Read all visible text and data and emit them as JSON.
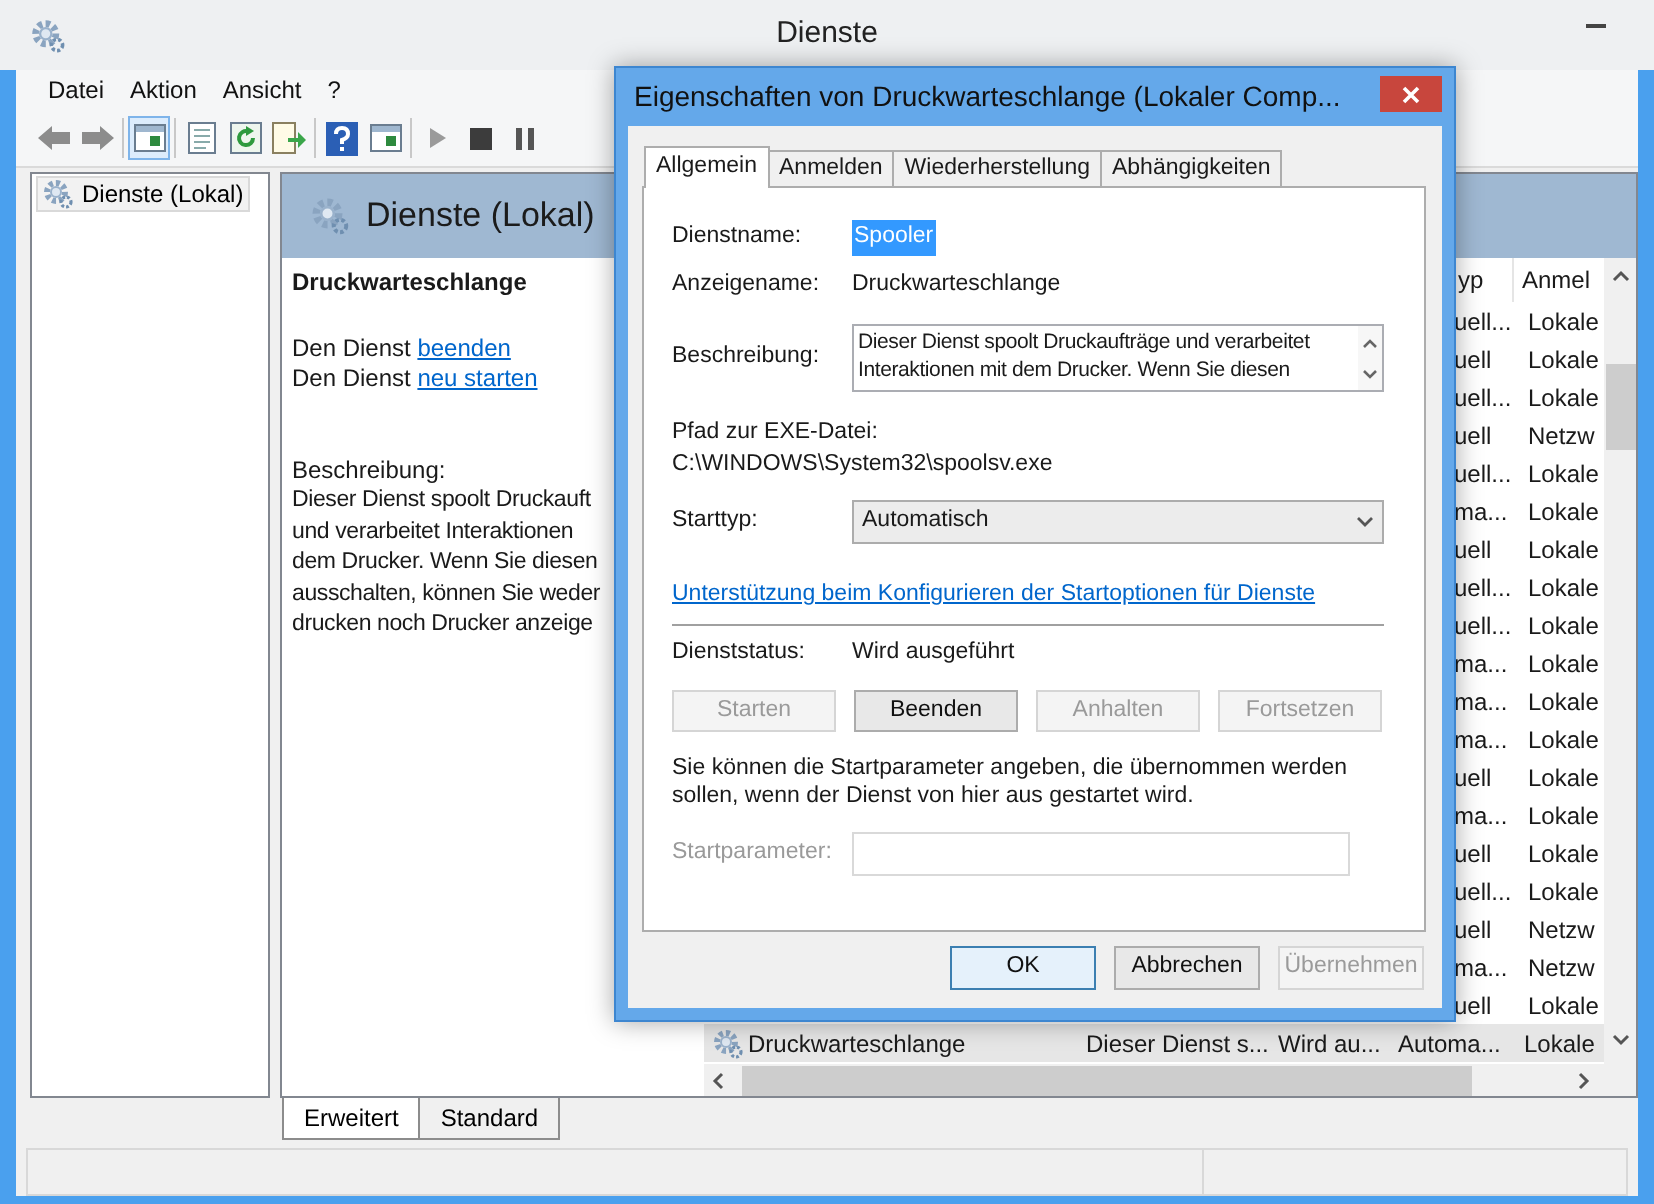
{
  "window": {
    "title": "Dienste"
  },
  "menu": [
    "Datei",
    "Aktion",
    "Ansicht",
    "?"
  ],
  "tree": [
    {
      "label": "Dienste (Lokal)",
      "selected": true
    }
  ],
  "panel_header": "Dienste (Lokal)",
  "details": {
    "title": "Druckwarteschlange",
    "actions": [
      {
        "prefix": "Den Dienst",
        "link": "beenden"
      },
      {
        "prefix": "Den Dienst",
        "link": "neu starten"
      }
    ],
    "description_label": "Beschreibung:",
    "description_lines": [
      "Dieser Dienst spoolt Druckauft",
      "und verarbeitet Interaktionen",
      "dem Drucker. Wenn Sie diesen",
      "ausschalten, können Sie weder",
      "drucken noch Drucker anzeige"
    ]
  },
  "list": {
    "columns": [
      "yp",
      "Anmel"
    ],
    "rows": [
      {
        "kind": "partial",
        "cells": [
          "uell...",
          "Lokale"
        ],
        "selected": false
      },
      {
        "kind": "partial",
        "cells": [
          "uell",
          "Lokale"
        ],
        "selected": false
      },
      {
        "kind": "partial",
        "cells": [
          "uell...",
          "Lokale"
        ],
        "selected": false
      },
      {
        "kind": "partial",
        "cells": [
          "uell",
          "Netzw"
        ],
        "selected": false
      },
      {
        "kind": "partial",
        "cells": [
          "uell...",
          "Lokale"
        ],
        "selected": false
      },
      {
        "kind": "partial",
        "cells": [
          "ma...",
          "Lokale"
        ],
        "selected": false
      },
      {
        "kind": "partial",
        "cells": [
          "uell",
          "Lokale"
        ],
        "selected": false
      },
      {
        "kind": "partial",
        "cells": [
          "uell...",
          "Lokale"
        ],
        "selected": false
      },
      {
        "kind": "partial",
        "cells": [
          "uell...",
          "Lokale"
        ],
        "selected": false
      },
      {
        "kind": "partial",
        "cells": [
          "ma...",
          "Lokale"
        ],
        "selected": false
      },
      {
        "kind": "partial",
        "cells": [
          "ma...",
          "Lokale"
        ],
        "selected": false
      },
      {
        "kind": "partial",
        "cells": [
          "ma...",
          "Lokale"
        ],
        "selected": false
      },
      {
        "kind": "partial",
        "cells": [
          "uell",
          "Lokale"
        ],
        "selected": false
      },
      {
        "kind": "partial",
        "cells": [
          "ma...",
          "Lokale"
        ],
        "selected": false
      },
      {
        "kind": "partial",
        "cells": [
          "uell",
          "Lokale"
        ],
        "selected": false
      },
      {
        "kind": "partial",
        "cells": [
          "uell...",
          "Lokale"
        ],
        "selected": false
      },
      {
        "kind": "partial",
        "cells": [
          "uell",
          "Netzw"
        ],
        "selected": false
      },
      {
        "kind": "partial",
        "cells": [
          "ma...",
          "Netzw"
        ],
        "selected": false
      },
      {
        "kind": "partial",
        "cells": [
          "uell",
          "Lokale"
        ],
        "selected": false
      },
      {
        "kind": "full",
        "name": "Druckwarteschlange",
        "cells": [
          "Dieser Dienst s...",
          "Wird au...",
          "Automa...",
          "Lokale"
        ],
        "selected": true
      }
    ]
  },
  "view_tabs": [
    {
      "label": "Erweitert",
      "selected": true
    },
    {
      "label": "Standard",
      "selected": false
    }
  ],
  "dialog": {
    "title": "Eigenschaften von Druckwarteschlange (Lokaler Comp...",
    "tabs": [
      {
        "label": "Allgemein",
        "selected": true
      },
      {
        "label": "Anmelden",
        "selected": false
      },
      {
        "label": "Wiederherstellung",
        "selected": false
      },
      {
        "label": "Abhängigkeiten",
        "selected": false
      }
    ],
    "service_name": {
      "label": "Dienstname:",
      "value": "Spooler",
      "highlighted": true
    },
    "display_name": {
      "label": "Anzeigename:",
      "value": "Druckwarteschlange"
    },
    "description": {
      "label": "Beschreibung:",
      "value": "Dieser Dienst spoolt Druckaufträge und verarbeitet Interaktionen mit dem Drucker. Wenn Sie diesen"
    },
    "exe_path": {
      "label": "Pfad zur EXE-Datei:",
      "value": "C:\\WINDOWS\\System32\\spoolsv.exe"
    },
    "start_type": {
      "label": "Starttyp:",
      "value": "Automatisch"
    },
    "help_link": "Unterstützung beim Konfigurieren der Startoptionen für Dienste",
    "status": {
      "label": "Dienststatus:",
      "value": "Wird ausgeführt"
    },
    "service_buttons": [
      {
        "label": "Starten",
        "disabled": true
      },
      {
        "label": "Beenden",
        "disabled": false
      },
      {
        "label": "Anhalten",
        "disabled": true
      },
      {
        "label": "Fortsetzen",
        "disabled": true
      }
    ],
    "start_params_note": "Sie können die Startparameter angeben, die übernommen werden sollen, wenn der Dienst von hier aus gestartet wird.",
    "start_params": {
      "label": "Startparameter:",
      "disabled": true
    },
    "buttons": [
      {
        "label": "OK",
        "default": true,
        "disabled": false
      },
      {
        "label": "Abbrechen",
        "default": false,
        "disabled": false
      },
      {
        "label": "Übernehmen",
        "default": false,
        "disabled": true
      }
    ]
  }
}
